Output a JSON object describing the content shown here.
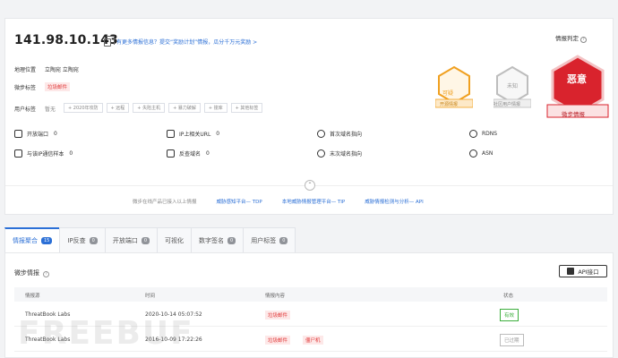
{
  "header": {
    "ip": "141.98.10.143",
    "note": "有更多情报信息？提交“奖励计划”情报，瓜分千万元奖励 >",
    "verdict_label": "情报判定",
    "verdict_help": "?"
  },
  "info": {
    "location_label": "地理位置",
    "location_value": "立陶宛 立陶宛",
    "tags_label": "微步标签",
    "tags": [
      "垃圾邮件"
    ],
    "user_tags_label": "用户标签",
    "user_tags_none": "暂无",
    "user_tags": [
      "+ 2020年攻防",
      "+ 远程",
      "+ 失陷主机",
      "+ 暴力破解",
      "+ 撞库",
      "+ 其他标签"
    ]
  },
  "stats": [
    {
      "label": "开放端口",
      "value": "0",
      "icon": "server-icon"
    },
    {
      "label": "IP上相关URL",
      "value": "0",
      "icon": "link-icon"
    },
    {
      "label": "首次域名指向",
      "value": "",
      "icon": "clock-icon"
    },
    {
      "label": "RDNS",
      "value": "",
      "icon": "globe-icon"
    },
    {
      "label": "与该IP通信样本",
      "value": "0",
      "icon": "file-icon"
    },
    {
      "label": "反查域名",
      "value": "0",
      "icon": "sitemap-icon"
    },
    {
      "label": "末次域名指向",
      "value": "",
      "icon": "clock-icon"
    },
    {
      "label": "ASN",
      "value": "",
      "icon": "cloud-icon"
    }
  ],
  "links": {
    "prefix": "微步在线产品已接入以上情报",
    "items": [
      "威胁感知平台— TDP",
      "本地威胁情报管理平台— TIP",
      "威胁情报检测与分析— API"
    ]
  },
  "badges": [
    {
      "title": "可疑",
      "label": "开源情报",
      "color": "#f0a020"
    },
    {
      "title": "未知",
      "label": "社区用户情报",
      "color": "#b5b5b5"
    },
    {
      "title": "恶意",
      "label": "微步情报",
      "color": "#d9232d"
    }
  ],
  "tabs": [
    {
      "label": "情报聚合",
      "count": "15"
    },
    {
      "label": "IP反查",
      "count": "0"
    },
    {
      "label": "开放端口",
      "count": "0"
    },
    {
      "label": "可视化",
      "count": ""
    },
    {
      "label": "数字签名",
      "count": "0"
    },
    {
      "label": "用户标签",
      "count": "0"
    }
  ],
  "panel": {
    "title": "微步情报",
    "api_button": "API接口",
    "columns": [
      "情报源",
      "时间",
      "情报内容",
      "状态"
    ],
    "rows": [
      {
        "source": "ThreatBook Labs",
        "time": "2020-10-14 05:07:52",
        "tags": [
          "垃圾邮件"
        ],
        "status": "有效",
        "status_color": "#3cae3c"
      },
      {
        "source": "ThreatBook Labs",
        "time": "2016-10-09 17:22:26",
        "tags": [
          "垃圾邮件",
          "僵尸机"
        ],
        "status": "已过期",
        "status_color": "#999999"
      }
    ]
  },
  "watermark": "FREEBUF"
}
